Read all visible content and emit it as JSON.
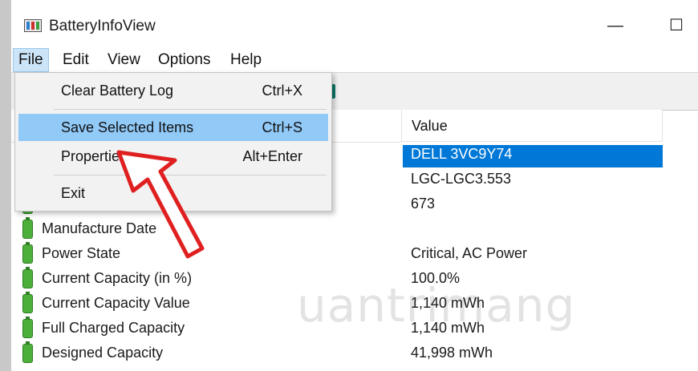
{
  "window": {
    "title": "BatteryInfoView",
    "minimize_glyph": "—",
    "maximize_glyph": "☐"
  },
  "menubar": {
    "items": [
      {
        "label": "File"
      },
      {
        "label": "Edit"
      },
      {
        "label": "View"
      },
      {
        "label": "Options"
      },
      {
        "label": "Help"
      }
    ]
  },
  "file_menu": {
    "items": [
      {
        "label": "Clear Battery Log",
        "shortcut": "Ctrl+X"
      },
      {
        "label": "Save Selected Items",
        "shortcut": "Ctrl+S"
      },
      {
        "label": "Properties",
        "shortcut": "Alt+Enter"
      },
      {
        "label": "Exit",
        "shortcut": ""
      }
    ]
  },
  "list": {
    "columns": [
      {
        "label": ""
      },
      {
        "label": "Value"
      }
    ],
    "rows": [
      {
        "name": "",
        "value": "DELL 3VC9Y74"
      },
      {
        "name": "",
        "value": "LGC-LGC3.553"
      },
      {
        "name": "",
        "value": "673"
      },
      {
        "name": "Manufacture Date",
        "value": ""
      },
      {
        "name": "Power State",
        "value": "Critical, AC Power"
      },
      {
        "name": "Current Capacity (in %)",
        "value": "100.0%"
      },
      {
        "name": "Current Capacity Value",
        "value": "1,140 mWh"
      },
      {
        "name": "Full Charged Capacity",
        "value": "1,140 mWh"
      },
      {
        "name": "Designed Capacity",
        "value": "41,998 mWh"
      }
    ]
  },
  "watermark": {
    "text": "uantrimang"
  },
  "colors": {
    "selection": "#0078d7",
    "menu_highlight": "#91c9f7",
    "battery_green": "#4caf3a",
    "arrow_red": "#e02020"
  }
}
